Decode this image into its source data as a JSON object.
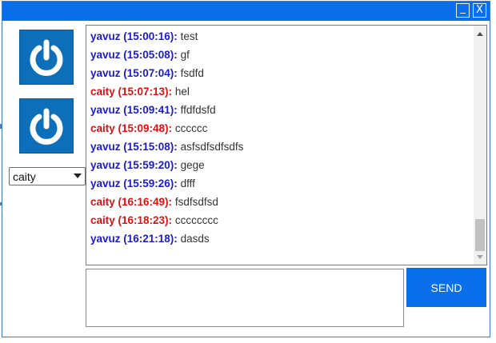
{
  "window": {
    "minimize_label": "_",
    "close_label": "X",
    "accent_color": "#0a6fea"
  },
  "avatars": [
    {
      "icon": "power-icon"
    },
    {
      "icon": "power-icon"
    }
  ],
  "user_select": {
    "selected": "caity"
  },
  "messages": [
    {
      "user": "yavuz",
      "sender": "yavuz (15:00:16):",
      "text": "test"
    },
    {
      "user": "yavuz",
      "sender": "yavuz (15:05:08):",
      "text": "gf"
    },
    {
      "user": "yavuz",
      "sender": "yavuz (15:07:04):",
      "text": "fsdfd"
    },
    {
      "user": "caity",
      "sender": "caity (15:07:13):",
      "text": "hel"
    },
    {
      "user": "yavuz",
      "sender": "yavuz (15:09:41):",
      "text": "ffdfdsfd"
    },
    {
      "user": "caity",
      "sender": "caity (15:09:48):",
      "text": "cccccc"
    },
    {
      "user": "yavuz",
      "sender": "yavuz (15:15:08):",
      "text": "asfsdfsdfsdfs"
    },
    {
      "user": "yavuz",
      "sender": "yavuz (15:59:20):",
      "text": "gege"
    },
    {
      "user": "yavuz",
      "sender": "yavuz (15:59:26):",
      "text": "dfff"
    },
    {
      "user": "caity",
      "sender": "caity (16:16:49):",
      "text": "fsdfsdfsd"
    },
    {
      "user": "caity",
      "sender": "caity (16:18:23):",
      "text": "cccccccc"
    },
    {
      "user": "yavuz",
      "sender": "yavuz (16:21:18):",
      "text": "dasds"
    }
  ],
  "user_colors": {
    "yavuz": "#1a1ad2",
    "caity": "#e01010"
  },
  "composer": {
    "value": "",
    "send_label": "SEND"
  }
}
